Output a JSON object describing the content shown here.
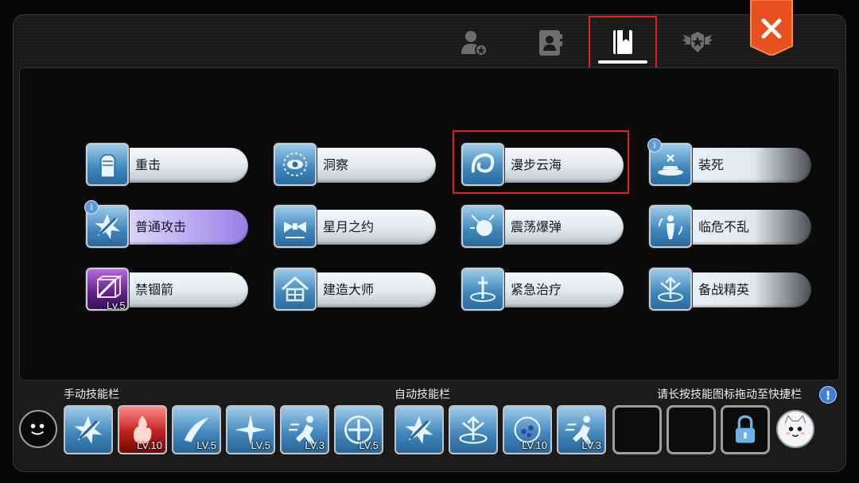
{
  "tabs": [
    {
      "name": "profile-tab",
      "icon": "person-star-icon"
    },
    {
      "name": "contacts-tab",
      "icon": "contact-book-icon"
    },
    {
      "name": "skill-book-tab",
      "icon": "book-icon",
      "active": true
    },
    {
      "name": "emblem-tab",
      "icon": "winged-star-emblem-icon"
    }
  ],
  "close_icon": "close-icon",
  "colors": {
    "highlight": "#e02020",
    "accent_blue": "#3f7fd6",
    "close_orange": "#e8501f"
  },
  "skills": [
    {
      "label": "重击",
      "icon": "fist-icon"
    },
    {
      "label": "洞察",
      "icon": "eye-sun-icon"
    },
    {
      "label": "漫步云海",
      "icon": "swirl-icon",
      "selected": true
    },
    {
      "label": "装死",
      "icon": "lying-figure-icon",
      "info": "i"
    },
    {
      "label": "普通攻击",
      "icon": "sword-burst-icon",
      "info": "i"
    },
    {
      "label": "星月之约",
      "icon": "bow-tie-icon"
    },
    {
      "label": "震荡爆弹",
      "icon": "bomb-icon"
    },
    {
      "label": "临危不乱",
      "icon": "person-cycle-icon"
    },
    {
      "label": "禁锢箭",
      "icon": "cube-arrow-icon",
      "level": "Lv.5"
    },
    {
      "label": "建造大师",
      "icon": "house-icon"
    },
    {
      "label": "紧急治疗",
      "icon": "sword-circle-icon"
    },
    {
      "label": "备战精英",
      "icon": "arrows-up-icon"
    }
  ],
  "bar": {
    "manual_label": "手动技能栏",
    "auto_label": "自动技能栏",
    "hint": "请长按技能图标拖动至快捷栏",
    "help_icon": "!",
    "manual_slots": [
      {
        "icon": "sword-burst-icon",
        "level": ""
      },
      {
        "icon": "fire-burst-icon",
        "level": "LV.10"
      },
      {
        "icon": "slash-icon",
        "level": "LV.5"
      },
      {
        "icon": "star-burst-icon",
        "level": "LV.5"
      },
      {
        "icon": "dash-figure-icon",
        "level": "LV.3"
      },
      {
        "icon": "cross-circle-icon",
        "level": "LV.5"
      }
    ],
    "auto_slots": [
      {
        "icon": "sword-burst-icon",
        "level": ""
      },
      {
        "icon": "arrows-up-icon",
        "level": ""
      },
      {
        "icon": "swirl-orb-icon",
        "level": "LV.10"
      },
      {
        "icon": "dash-figure-icon",
        "level": "LV.3"
      },
      {
        "icon": "empty-slot",
        "level": ""
      },
      {
        "icon": "empty-slot",
        "level": ""
      },
      {
        "icon": "lock-icon",
        "level": ""
      }
    ]
  }
}
